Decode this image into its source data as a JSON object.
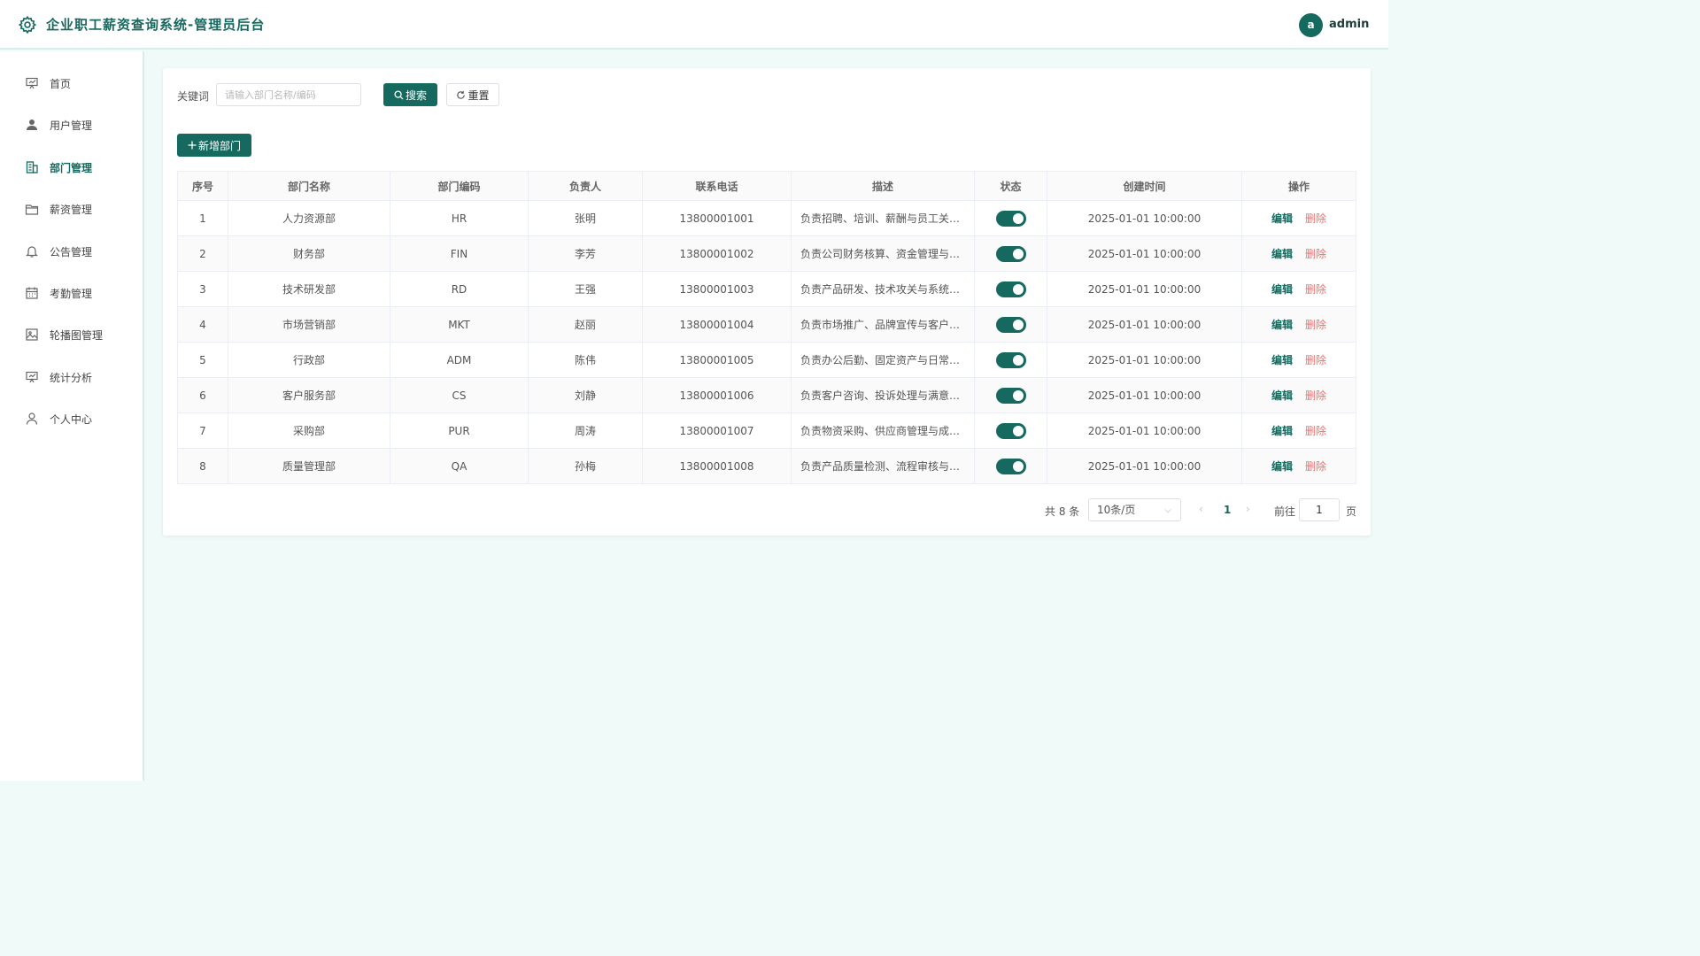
{
  "header": {
    "title": "企业职工薪资查询系统-管理员后台",
    "avatar_letter": "a",
    "username": "admin"
  },
  "sidebar": {
    "items": [
      {
        "label": "首页",
        "icon": "presentation-icon"
      },
      {
        "label": "用户管理",
        "icon": "user-icon"
      },
      {
        "label": "部门管理",
        "icon": "building-icon"
      },
      {
        "label": "薪资管理",
        "icon": "folder-icon"
      },
      {
        "label": "公告管理",
        "icon": "bell-icon"
      },
      {
        "label": "考勤管理",
        "icon": "calendar-icon"
      },
      {
        "label": "轮播图管理",
        "icon": "picture-icon"
      },
      {
        "label": "统计分析",
        "icon": "chart-icon"
      },
      {
        "label": "个人中心",
        "icon": "profile-icon"
      }
    ],
    "active_label": "部门管理"
  },
  "search": {
    "label": "关键词",
    "placeholder": "请输入部门名称/编码",
    "value": "",
    "search_label": "搜索",
    "reset_label": "重置"
  },
  "actions": {
    "add_label": "新增部门"
  },
  "table": {
    "columns": [
      "序号",
      "部门名称",
      "部门编码",
      "负责人",
      "联系电话",
      "描述",
      "状态",
      "创建时间",
      "操作"
    ],
    "edit_label": "编辑",
    "delete_label": "删除",
    "rows": [
      {
        "index": "1",
        "name": "人力资源部",
        "code": "HR",
        "leader": "张明",
        "phone": "13800001001",
        "desc": "负责招聘、培训、薪酬与员工关系管理",
        "status": true,
        "created": "2025-01-01 10:00:00"
      },
      {
        "index": "2",
        "name": "财务部",
        "code": "FIN",
        "leader": "李芳",
        "phone": "13800001002",
        "desc": "负责公司财务核算、资金管理与税务筹划",
        "status": true,
        "created": "2025-01-01 10:00:00"
      },
      {
        "index": "3",
        "name": "技术研发部",
        "code": "RD",
        "leader": "王强",
        "phone": "13800001003",
        "desc": "负责产品研发、技术攻关与系统维护",
        "status": true,
        "created": "2025-01-01 10:00:00"
      },
      {
        "index": "4",
        "name": "市场营销部",
        "code": "MKT",
        "leader": "赵丽",
        "phone": "13800001004",
        "desc": "负责市场推广、品牌宣传与客户拓展",
        "status": true,
        "created": "2025-01-01 10:00:00"
      },
      {
        "index": "5",
        "name": "行政部",
        "code": "ADM",
        "leader": "陈伟",
        "phone": "13800001005",
        "desc": "负责办公后勤、固定资产与日常行政事务",
        "status": true,
        "created": "2025-01-01 10:00:00"
      },
      {
        "index": "6",
        "name": "客户服务部",
        "code": "CS",
        "leader": "刘静",
        "phone": "13800001006",
        "desc": "负责客户咨询、投诉处理与满意度回访",
        "status": true,
        "created": "2025-01-01 10:00:00"
      },
      {
        "index": "7",
        "name": "采购部",
        "code": "PUR",
        "leader": "周涛",
        "phone": "13800001007",
        "desc": "负责物资采购、供应商管理与成本控制",
        "status": true,
        "created": "2025-01-01 10:00:00"
      },
      {
        "index": "8",
        "name": "质量管理部",
        "code": "QA",
        "leader": "孙梅",
        "phone": "13800001008",
        "desc": "负责产品质量检测、流程审核与标准制定",
        "status": true,
        "created": "2025-01-01 10:00:00"
      }
    ]
  },
  "pagination": {
    "total_text": "共 8 条",
    "page_size": "10条/页",
    "current_page": "1",
    "goto_label": "前往",
    "goto_value": "1",
    "page_suffix": "页"
  },
  "colors": {
    "primary": "#16695f",
    "danger": "#f56c6c",
    "background": "#f0faf8"
  }
}
